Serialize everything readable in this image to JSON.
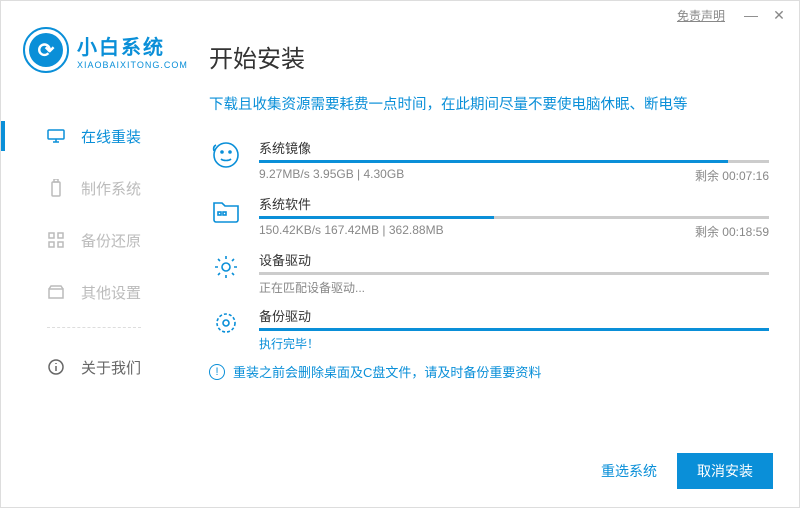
{
  "titlebar": {
    "disclaimer": "免责声明"
  },
  "brand": {
    "name": "小白系统",
    "url": "XIAOBAIXITONG.COM"
  },
  "page_title": "开始安装",
  "nav": {
    "items": [
      {
        "label": "在线重装"
      },
      {
        "label": "制作系统"
      },
      {
        "label": "备份还原"
      },
      {
        "label": "其他设置"
      },
      {
        "label": "关于我们"
      }
    ]
  },
  "hint": "下载且收集资源需要耗费一点时间，在此期间尽量不要使电脑休眠、断电等",
  "tasks": [
    {
      "title": "系统镜像",
      "detail": "9.27MB/s 3.95GB | 4.30GB",
      "eta": "剩余 00:07:16",
      "progress": 92
    },
    {
      "title": "系统软件",
      "detail": "150.42KB/s 167.42MB | 362.88MB",
      "eta": "剩余 00:18:59",
      "progress": 46
    },
    {
      "title": "设备驱动",
      "detail": "正在匹配设备驱动...",
      "eta": "",
      "progress": 0
    },
    {
      "title": "备份驱动",
      "detail": "执行完毕！",
      "eta": "",
      "progress": 100
    }
  ],
  "warning": "重装之前会删除桌面及C盘文件，请及时备份重要资料",
  "footer": {
    "secondary": "重选系统",
    "primary": "取消安装"
  },
  "icons": {
    "nav0": "monitor-icon",
    "nav1": "usb-icon",
    "nav2": "grid-icon",
    "nav3": "box-icon",
    "nav4": "info-icon",
    "task0": "face-icon",
    "task1": "folder-icon",
    "task2": "gear-icon",
    "task3": "gear-icon"
  }
}
